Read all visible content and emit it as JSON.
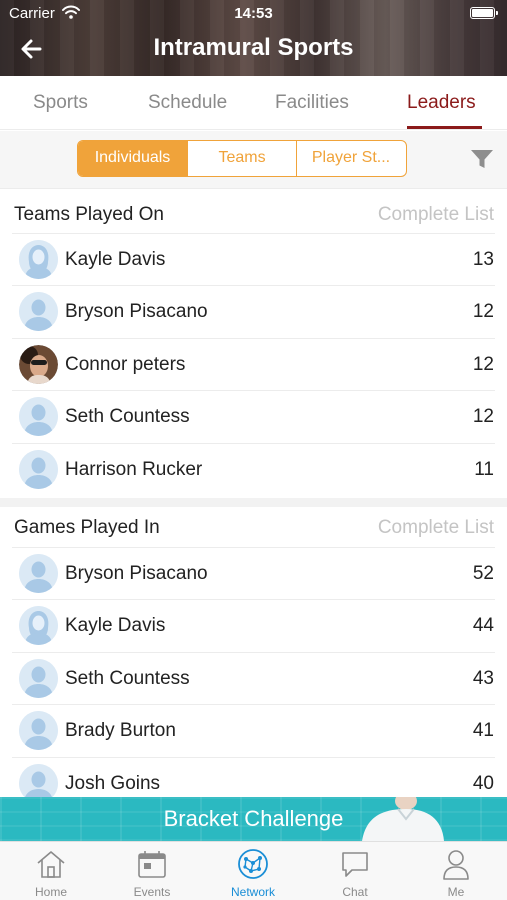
{
  "status_bar": {
    "carrier": "Carrier",
    "time": "14:53"
  },
  "header": {
    "title": "Intramural Sports"
  },
  "tabs": [
    {
      "label": "Sports",
      "active": false
    },
    {
      "label": "Schedule",
      "active": false
    },
    {
      "label": "Facilities",
      "active": false
    },
    {
      "label": "Leaders",
      "active": true
    }
  ],
  "segments": [
    {
      "label": "Individuals",
      "active": true
    },
    {
      "label": "Teams",
      "active": false
    },
    {
      "label": "Player St...",
      "active": false
    }
  ],
  "sections": [
    {
      "title": "Teams Played On",
      "link": "Complete List",
      "rows": [
        {
          "name": "Kayle Davis",
          "value": "13",
          "avatar": "female-placeholder"
        },
        {
          "name": "Bryson Pisacano",
          "value": "12",
          "avatar": "male-placeholder"
        },
        {
          "name": "Connor peters",
          "value": "12",
          "avatar": "photo"
        },
        {
          "name": "Seth Countess",
          "value": "12",
          "avatar": "male-placeholder"
        },
        {
          "name": "Harrison Rucker",
          "value": "11",
          "avatar": "male-placeholder"
        }
      ]
    },
    {
      "title": "Games Played In",
      "link": "Complete List",
      "rows": [
        {
          "name": "Bryson Pisacano",
          "value": "52",
          "avatar": "male-placeholder"
        },
        {
          "name": "Kayle Davis",
          "value": "44",
          "avatar": "female-placeholder"
        },
        {
          "name": "Seth Countess",
          "value": "43",
          "avatar": "male-placeholder"
        },
        {
          "name": "Brady Burton",
          "value": "41",
          "avatar": "male-placeholder"
        },
        {
          "name": "Josh Goins",
          "value": "40",
          "avatar": "male-placeholder"
        }
      ]
    }
  ],
  "banner": {
    "label": "Bracket Challenge"
  },
  "bottom_nav": [
    {
      "label": "Home",
      "icon": "home-icon",
      "active": false
    },
    {
      "label": "Events",
      "icon": "calendar-icon",
      "active": false
    },
    {
      "label": "Network",
      "icon": "network-icon",
      "active": true
    },
    {
      "label": "Chat",
      "icon": "chat-icon",
      "active": false
    },
    {
      "label": "Me",
      "icon": "person-icon",
      "active": false
    }
  ],
  "colors": {
    "accent": "#f0a33a",
    "leaders_tab": "#8b1a1a",
    "nav_active": "#1a8ed6",
    "banner": "#2bb9c1"
  }
}
